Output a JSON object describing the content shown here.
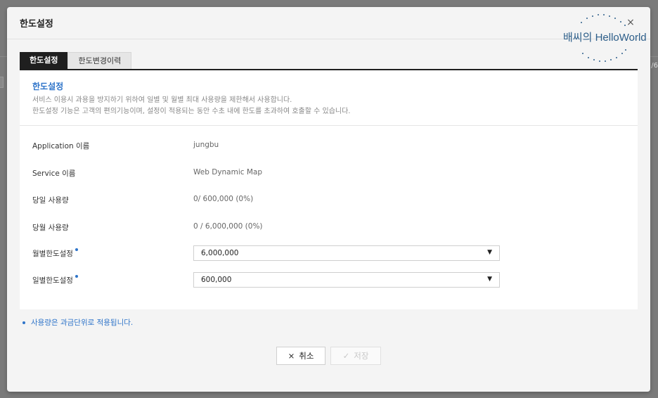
{
  "background": {
    "right_fragment": "/6"
  },
  "modal": {
    "title": "한도설정",
    "close_glyph": "×"
  },
  "watermark": {
    "text": "배씨의 HelloWorld"
  },
  "tabs": [
    {
      "label": "한도설정",
      "active": true
    },
    {
      "label": "한도변경이력",
      "active": false
    }
  ],
  "intro": {
    "title": "한도설정",
    "lines": [
      "서비스 이용시 과용을 방지하기 위하여 일별 및 월별 최대 사용량을 제한해서 사용합니다.",
      "한도설정 기능은 고객의 편의기능이며, 설정이 적용되는 동안 수초 내에 한도를 초과하여 호출할 수 있습니다."
    ]
  },
  "form": {
    "application": {
      "label": "Application 이름",
      "value": "jungbu"
    },
    "service": {
      "label": "Service 이름",
      "value": "Web Dynamic Map"
    },
    "daily_usage": {
      "label": "당일 사용량",
      "value": "0/ 600,000 (0%)"
    },
    "monthly_usage": {
      "label": "당월 사용량",
      "value": "0 / 6,000,000 (0%)"
    },
    "monthly_limit": {
      "label": "월별한도설정",
      "selected": "6,000,000",
      "required": true
    },
    "daily_limit": {
      "label": "일별한도설정",
      "selected": "600,000",
      "required": true
    }
  },
  "note": "사용량은 과금단위로 적용됩니다.",
  "buttons": {
    "cancel": {
      "icon": "×",
      "label": "취소"
    },
    "save": {
      "icon": "✓",
      "label": "저장",
      "disabled": true
    }
  },
  "colors": {
    "accent": "#2e74c9",
    "tab_active": "#1f1f1f",
    "backdrop": "#7a7a7a"
  },
  "icons": {
    "close": "close-icon",
    "dropdown": "chevron-down-icon",
    "cancel": "x-icon",
    "save": "check-icon"
  }
}
